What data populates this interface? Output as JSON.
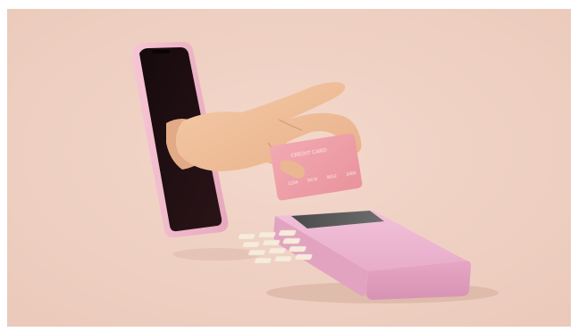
{
  "image": {
    "card_title": "CREDIT CARD",
    "card_number_groups": [
      "1234",
      "5678",
      "9012",
      "3456"
    ]
  }
}
